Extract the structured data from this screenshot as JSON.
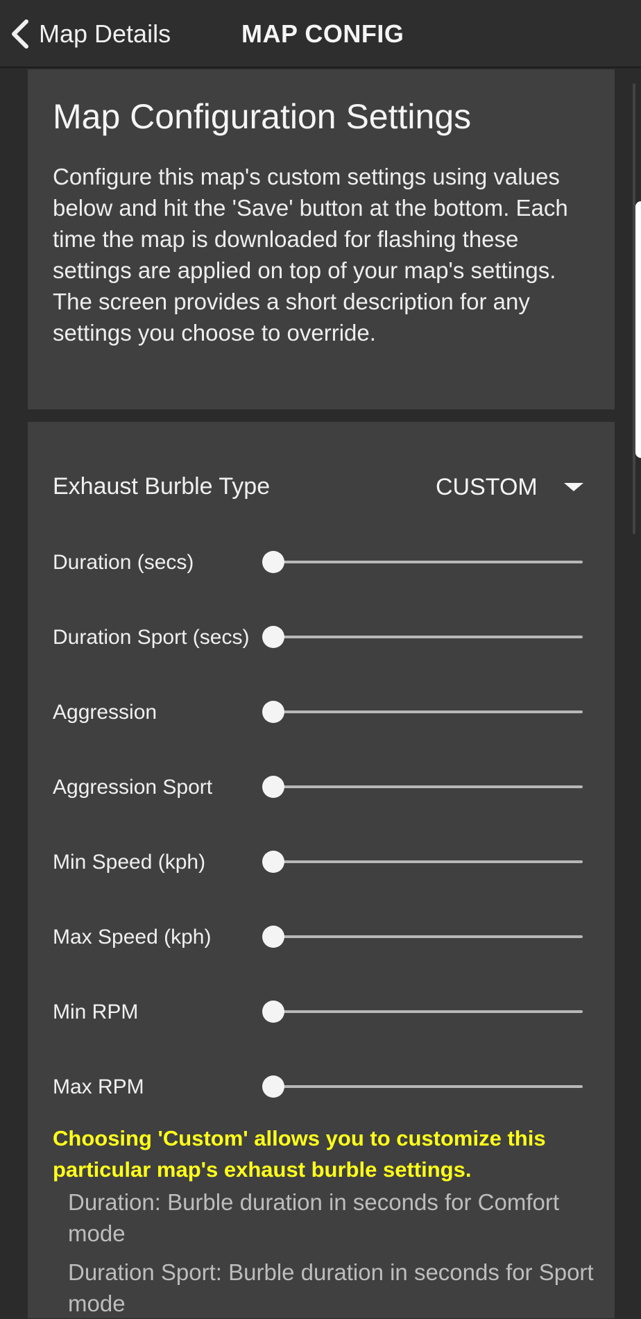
{
  "header": {
    "back_label": "Map Details",
    "title": "MAP CONFIG"
  },
  "intro": {
    "title": "Map Configuration Settings",
    "text": "Configure this map's custom settings using values below and hit the 'Save' button at the bottom. Each time the map is downloaded for flashing these settings are applied on top of your map's settings. The screen provides a short description for any settings you choose to override."
  },
  "burble": {
    "label": "Exhaust Burble Type",
    "selected": "CUSTOM"
  },
  "sliders": [
    {
      "label": "Duration (secs)",
      "value": 0
    },
    {
      "label": "Duration Sport (secs)",
      "value": 0
    },
    {
      "label": "Aggression",
      "value": 0
    },
    {
      "label": "Aggression Sport",
      "value": 0
    },
    {
      "label": "Min Speed (kph)",
      "value": 0
    },
    {
      "label": "Max Speed (kph)",
      "value": 0
    },
    {
      "label": "Min RPM",
      "value": 0
    },
    {
      "label": "Max RPM",
      "value": 0
    }
  ],
  "note": "Choosing 'Custom' allows you to customize this particular map's exhaust burble settings.",
  "descriptions": [
    "Duration: Burble duration in seconds for Comfort mode",
    "Duration Sport: Burble duration in seconds for Sport mode"
  ],
  "icons": {
    "back": "chevron-left-icon",
    "dropdown": "caret-down-icon"
  },
  "colors": {
    "note": "#ffff1a",
    "card": "#404040",
    "background": "#2b2b2b"
  }
}
